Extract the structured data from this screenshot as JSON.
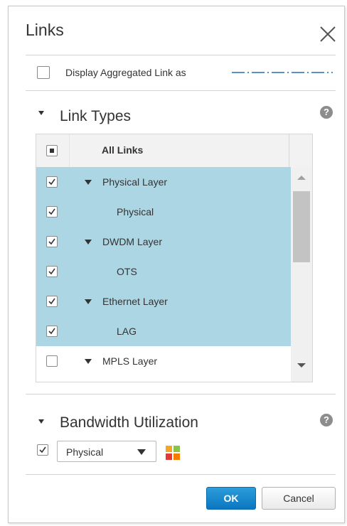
{
  "dialog": {
    "title": "Links"
  },
  "aggregated": {
    "label": "Display Aggregated Link as",
    "checked": false
  },
  "link_types": {
    "title": "Link Types",
    "header": "All Links",
    "header_state": "partial",
    "rows": [
      {
        "label": "Physical Layer",
        "checked": true,
        "expandable": true,
        "selected": true
      },
      {
        "label": "Physical",
        "checked": true,
        "expandable": false,
        "selected": true
      },
      {
        "label": "DWDM Layer",
        "checked": true,
        "expandable": true,
        "selected": true
      },
      {
        "label": "OTS",
        "checked": true,
        "expandable": false,
        "selected": true
      },
      {
        "label": "Ethernet Layer",
        "checked": true,
        "expandable": true,
        "selected": true
      },
      {
        "label": "LAG",
        "checked": true,
        "expandable": false,
        "selected": true
      },
      {
        "label": "MPLS Layer",
        "checked": false,
        "expandable": true,
        "selected": false
      }
    ]
  },
  "bandwidth": {
    "title": "Bandwidth Utilization",
    "checked": true,
    "select_value": "Physical"
  },
  "buttons": {
    "ok": "OK",
    "cancel": "Cancel"
  },
  "colors": {
    "selected_row": "#acd6e4",
    "primary_button": "#0a76c0",
    "dash_line": "#1f6fb2",
    "legend_swatches": [
      "#f5a623",
      "#8bc34a",
      "#e53935",
      "#f57c00"
    ]
  },
  "icons": {
    "close": "close-icon",
    "help": "help-icon",
    "collapse": "triangle-down-icon",
    "checkbox": "checkmark-icon",
    "legend": "color-legend-icon"
  }
}
